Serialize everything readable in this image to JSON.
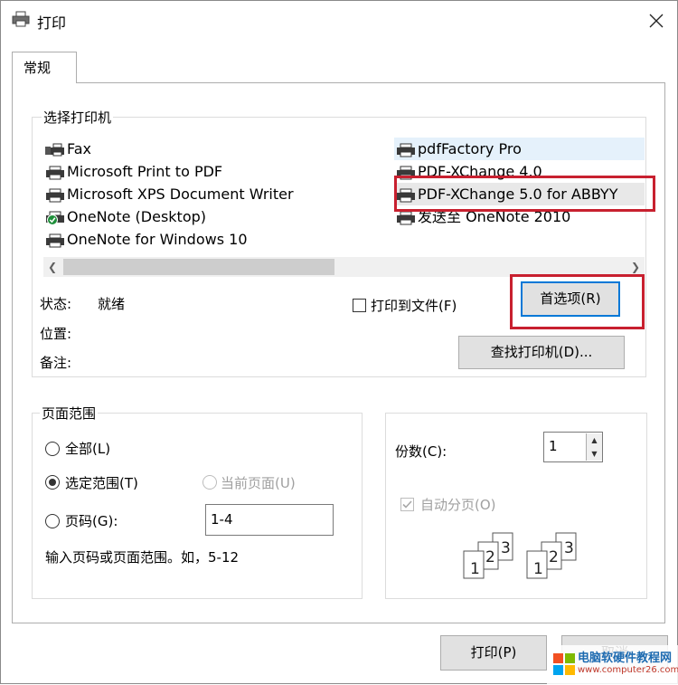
{
  "window": {
    "title": "打印"
  },
  "tabs": [
    {
      "label": "常规"
    }
  ],
  "printer_group": {
    "label": "选择打印机",
    "printers_left": [
      {
        "name": "Fax",
        "icon": "fax-printer-icon"
      },
      {
        "name": "Microsoft Print to PDF",
        "icon": "printer-icon"
      },
      {
        "name": "Microsoft XPS Document Writer",
        "icon": "printer-icon"
      },
      {
        "name": "OneNote (Desktop)",
        "icon": "default-printer-check-icon"
      },
      {
        "name": "OneNote for Windows 10",
        "icon": "printer-icon"
      }
    ],
    "printers_right": [
      {
        "name": "pdfFactory Pro",
        "icon": "printer-icon"
      },
      {
        "name": "PDF-XChange 4.0",
        "icon": "printer-icon"
      },
      {
        "name": "PDF-XChange 5.0 for ABBYY",
        "icon": "printer-icon"
      },
      {
        "name": "发送至 OneNote 2010",
        "icon": "printer-icon"
      }
    ],
    "status_label": "状态:",
    "status_value": "就绪",
    "location_label": "位置:",
    "comment_label": "备注:",
    "print_to_file_label": "打印到文件(F)",
    "preferences_button": "首选项(R)",
    "find_printer_button": "查找打印机(D)..."
  },
  "page_range": {
    "label": "页面范围",
    "all_label": "全部(L)",
    "selection_label": "选定范围(T)",
    "current_page_label": "当前页面(U)",
    "pages_label": "页码(G):",
    "pages_value": "1-4",
    "hint": "输入页码或页面范围。如，5-12",
    "selected_option": "selection"
  },
  "copies": {
    "label": "份数(C):",
    "value": "1",
    "collate_label": "自动分页(O)",
    "collate_checked": true,
    "collate_enabled": false
  },
  "footer": {
    "print_button": "打印(P)",
    "cancel_button": "取消"
  },
  "watermark": {
    "line1": "电脑软硬件教程网",
    "line2": "www.computer26.com"
  },
  "colors": {
    "highlight_red": "#c8202f",
    "selection_blue": "#e5f1fb",
    "accent": "#0078d7"
  }
}
